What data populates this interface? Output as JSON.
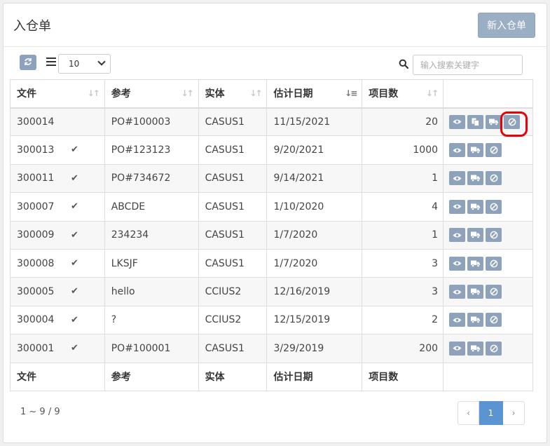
{
  "header": {
    "title": "入仓单",
    "new_button": "新入仓单"
  },
  "toolbar": {
    "page_size": "10",
    "search_placeholder": "输入搜索关键字"
  },
  "columns": [
    "文件",
    "参考",
    "实体",
    "估计日期",
    "项目数"
  ],
  "rows": [
    {
      "doc": "300014",
      "checked": false,
      "ref": "PO#100003",
      "entity": "CASUS1",
      "date": "11/15/2021",
      "count": "20",
      "actions": [
        "view",
        "copy",
        "truck",
        "cancel"
      ]
    },
    {
      "doc": "300013",
      "checked": true,
      "ref": "PO#123123",
      "entity": "CASUS1",
      "date": "9/20/2021",
      "count": "1000",
      "actions": [
        "view",
        "truck",
        "cancel"
      ]
    },
    {
      "doc": "300011",
      "checked": true,
      "ref": "PO#734672",
      "entity": "CASUS1",
      "date": "9/14/2021",
      "count": "1",
      "actions": [
        "view",
        "truck",
        "cancel"
      ]
    },
    {
      "doc": "300007",
      "checked": true,
      "ref": "ABCDE",
      "entity": "CASUS1",
      "date": "1/10/2020",
      "count": "4",
      "actions": [
        "view",
        "truck",
        "cancel"
      ]
    },
    {
      "doc": "300009",
      "checked": true,
      "ref": "234234",
      "entity": "CASUS1",
      "date": "1/7/2020",
      "count": "1",
      "actions": [
        "view",
        "truck",
        "cancel"
      ]
    },
    {
      "doc": "300008",
      "checked": true,
      "ref": "LKSJF",
      "entity": "CASUS1",
      "date": "1/7/2020",
      "count": "3",
      "actions": [
        "view",
        "truck",
        "cancel"
      ]
    },
    {
      "doc": "300005",
      "checked": true,
      "ref": "hello",
      "entity": "CCIUS2",
      "date": "12/16/2019",
      "count": "3",
      "actions": [
        "view",
        "truck",
        "cancel"
      ]
    },
    {
      "doc": "300004",
      "checked": true,
      "ref": "?",
      "entity": "CCIUS2",
      "date": "12/15/2019",
      "count": "2",
      "actions": [
        "view",
        "truck",
        "cancel"
      ]
    },
    {
      "doc": "300001",
      "checked": true,
      "ref": "PO#100001",
      "entity": "CASUS1",
      "date": "3/29/2019",
      "count": "200",
      "actions": [
        "view",
        "truck",
        "cancel"
      ]
    }
  ],
  "footer": {
    "info": "1 ~ 9 / 9",
    "prev": "‹",
    "page": "1",
    "next": "›"
  }
}
